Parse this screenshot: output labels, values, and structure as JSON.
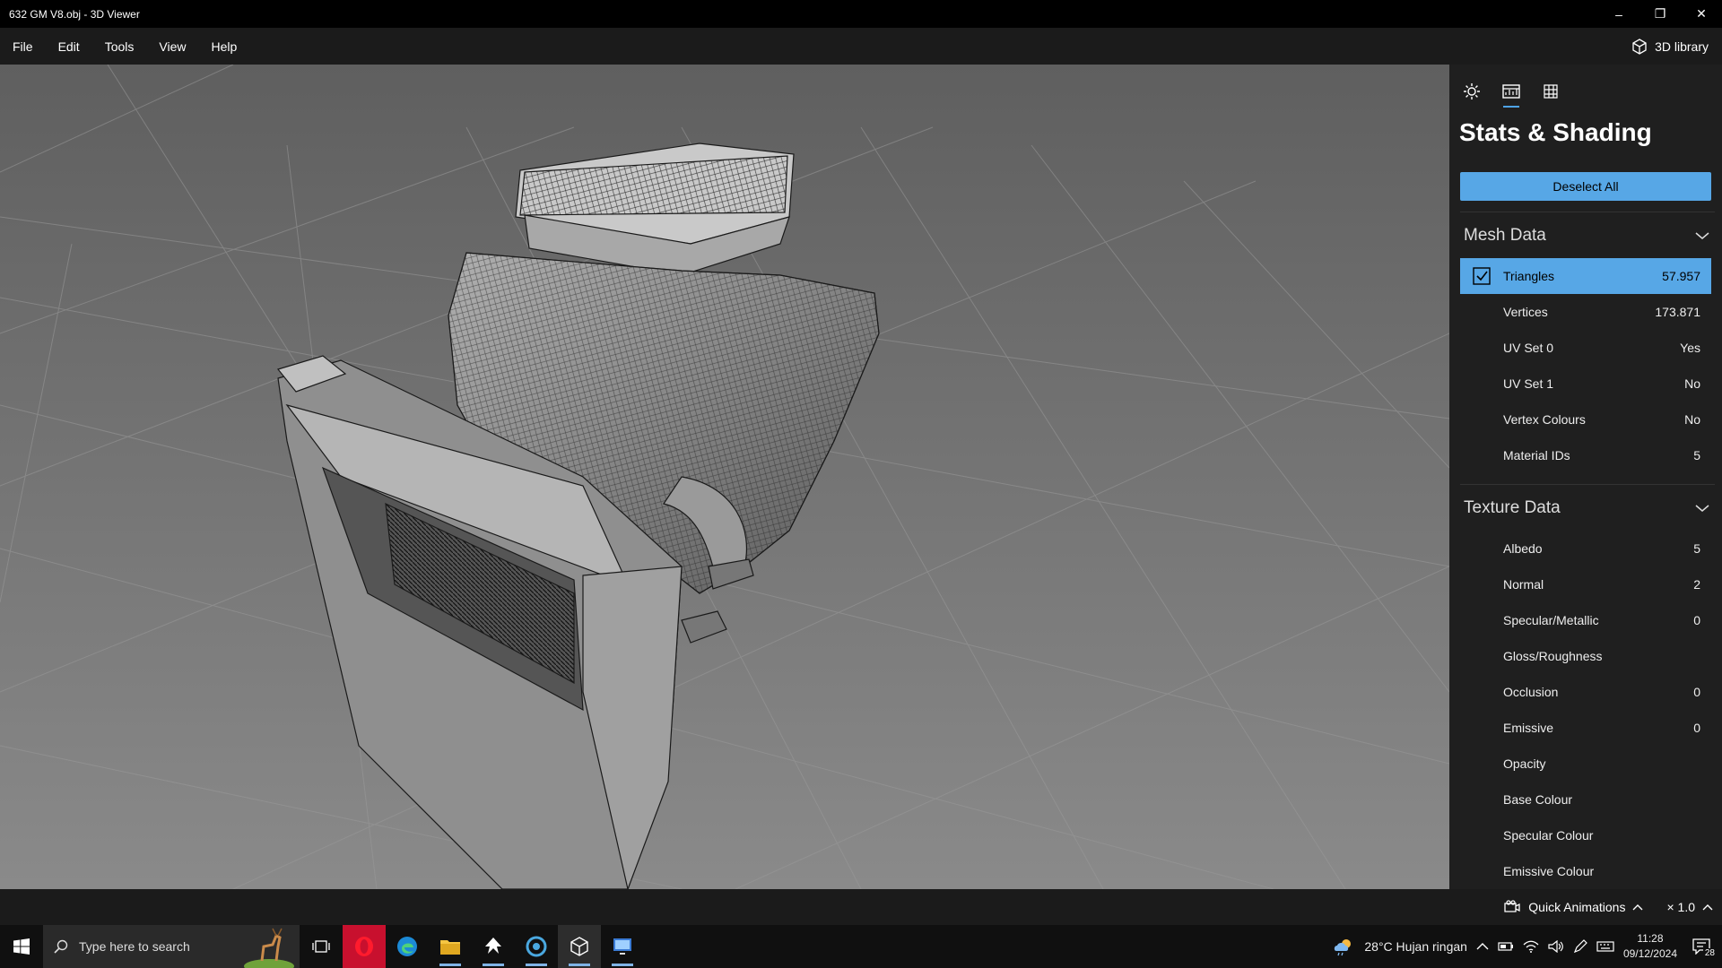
{
  "window": {
    "title": "632 GM V8.obj - 3D Viewer",
    "minimize": "–",
    "restore": "❐",
    "close": "✕"
  },
  "menu": {
    "items": [
      "File",
      "Edit",
      "Tools",
      "View",
      "Help"
    ],
    "library_label": "3D library",
    "library_icon": "cube-icon"
  },
  "panel": {
    "tabs": [
      {
        "icon": "lighting-icon"
      },
      {
        "icon": "stats-icon",
        "active": true
      },
      {
        "icon": "grid-icon"
      }
    ],
    "title": "Stats & Shading",
    "deselect_label": "Deselect All",
    "mesh_section": "Mesh Data",
    "mesh_rows": [
      {
        "label": "Triangles",
        "value": "57.957",
        "selected": true,
        "checked": true
      },
      {
        "label": "Vertices",
        "value": "173.871"
      },
      {
        "label": "UV Set 0",
        "value": "Yes"
      },
      {
        "label": "UV Set 1",
        "value": "No"
      },
      {
        "label": "Vertex Colours",
        "value": "No"
      },
      {
        "label": "Material IDs",
        "value": "5"
      }
    ],
    "texture_section": "Texture Data",
    "texture_rows": [
      {
        "label": "Albedo",
        "value": "5"
      },
      {
        "label": "Normal",
        "value": "2"
      },
      {
        "label": "Specular/Metallic",
        "value": "0"
      },
      {
        "label": "Gloss/Roughness",
        "value": ""
      },
      {
        "label": "Occlusion",
        "value": "0"
      },
      {
        "label": "Emissive",
        "value": "0"
      },
      {
        "label": "Opacity",
        "value": ""
      },
      {
        "label": "Base Colour",
        "value": ""
      },
      {
        "label": "Specular Colour",
        "value": ""
      },
      {
        "label": "Emissive Colour",
        "value": ""
      }
    ],
    "accent": "#57a7e6"
  },
  "status": {
    "quick_animations": "Quick Animations",
    "speed": "× 1.0"
  },
  "taskbar": {
    "search_placeholder": "Type here to search",
    "weather": "28°C  Hujan ringan",
    "time": "11:28",
    "date": "09/12/2024",
    "notifications": "28"
  }
}
